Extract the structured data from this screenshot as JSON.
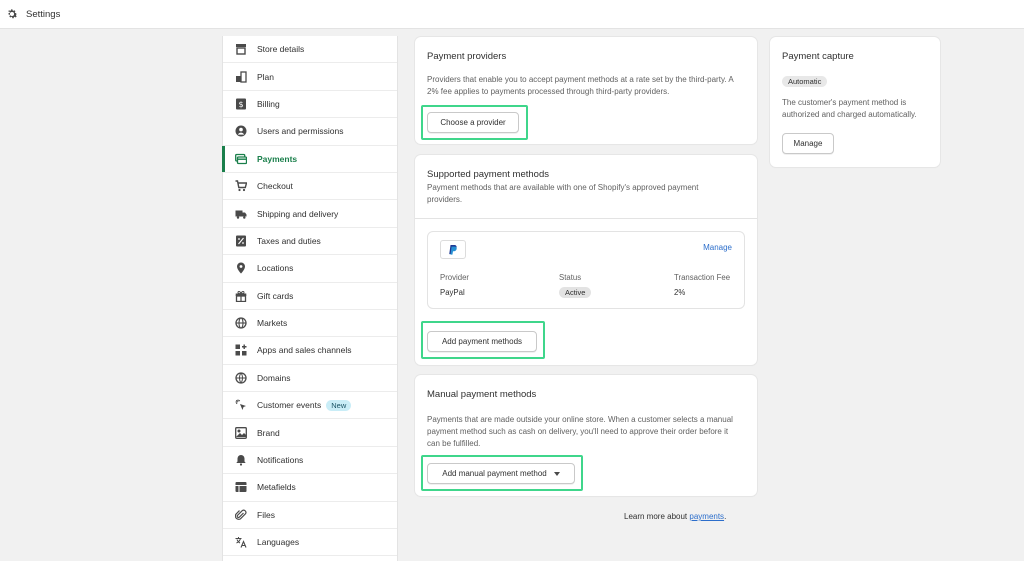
{
  "topbar": {
    "title": "Settings"
  },
  "sidebar": {
    "items": [
      {
        "label": "Store details"
      },
      {
        "label": "Plan"
      },
      {
        "label": "Billing"
      },
      {
        "label": "Users and permissions"
      },
      {
        "label": "Payments"
      },
      {
        "label": "Checkout"
      },
      {
        "label": "Shipping and delivery"
      },
      {
        "label": "Taxes and duties"
      },
      {
        "label": "Locations"
      },
      {
        "label": "Gift cards"
      },
      {
        "label": "Markets"
      },
      {
        "label": "Apps and sales channels"
      },
      {
        "label": "Domains"
      },
      {
        "label": "Customer events",
        "badge": "New"
      },
      {
        "label": "Brand"
      },
      {
        "label": "Notifications"
      },
      {
        "label": "Metafields"
      },
      {
        "label": "Files"
      },
      {
        "label": "Languages"
      }
    ]
  },
  "providers": {
    "title": "Payment providers",
    "desc": "Providers that enable you to accept payment methods at a rate set by the third-party. A 2% fee applies to payments processed through third-party providers.",
    "button": "Choose a provider"
  },
  "supported": {
    "title": "Supported payment methods",
    "desc": "Payment methods that are available with one of Shopify's approved payment providers.",
    "manage": "Manage",
    "col_provider": "Provider",
    "col_status": "Status",
    "col_fee": "Transaction Fee",
    "provider": "PayPal",
    "status": "Active",
    "fee": "2%",
    "button": "Add payment methods"
  },
  "manual": {
    "title": "Manual payment methods",
    "desc": "Payments that are made outside your online store. When a customer selects a manual payment method such as cash on delivery, you'll need to approve their order before it can be fulfilled.",
    "button": "Add manual payment method"
  },
  "capture": {
    "title": "Payment capture",
    "badge": "Automatic",
    "desc": "The customer's payment method is authorized and charged automatically.",
    "button": "Manage"
  },
  "footer": {
    "text": "Learn more about ",
    "link": "payments",
    "period": "."
  },
  "colors": {
    "accent": "#1a7f4b",
    "highlight": "#3fd68b",
    "link": "#2c6ecb"
  }
}
